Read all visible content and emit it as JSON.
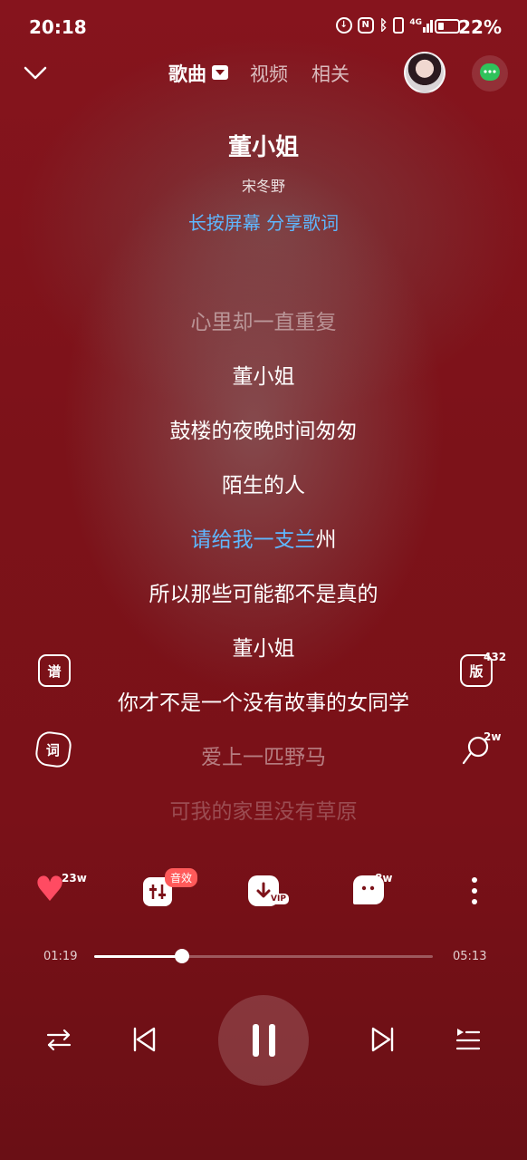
{
  "status_bar": {
    "time": "20:18",
    "battery_pct": "22%",
    "battery_level": 0.22,
    "icons": [
      "data-saver-icon",
      "nfc-icon",
      "bluetooth-icon",
      "vibrate-icon",
      "signal-4g-icon",
      "battery-icon"
    ],
    "signal_label": "4G"
  },
  "header": {
    "tabs": [
      {
        "label": "歌曲",
        "active": true
      },
      {
        "label": "视频",
        "active": false
      },
      {
        "label": "相关",
        "active": false
      }
    ]
  },
  "song": {
    "title": "董小姐",
    "artist": "宋冬野",
    "share_hint": "长按屏幕 分享歌词"
  },
  "lyrics": [
    {
      "text": "心里却一直重复",
      "state": "dim"
    },
    {
      "text": "董小姐",
      "state": "normal"
    },
    {
      "text": "鼓楼的夜晚时间匆匆",
      "state": "normal"
    },
    {
      "text": "陌生的人",
      "state": "normal"
    },
    {
      "text_sung": "请给我一支兰",
      "text_rest": "州",
      "state": "current"
    },
    {
      "text": "所以那些可能都不是真的",
      "state": "normal"
    },
    {
      "text": "董小姐",
      "state": "normal"
    },
    {
      "text": "你才不是一个没有故事的女同学",
      "state": "normal"
    },
    {
      "text": "爱上一匹野马",
      "state": "dim"
    },
    {
      "text": "可我的家里没有草原",
      "state": "faint"
    }
  ],
  "side_buttons": {
    "score": {
      "label": "谱"
    },
    "version": {
      "label": "版",
      "count": "432"
    },
    "lyric": {
      "label": "词"
    },
    "ringtone": {
      "count": "2w"
    }
  },
  "actions": {
    "like_count": "23w",
    "effects_tag": "音效",
    "vip_tag": "VIP",
    "comment_count": "8w"
  },
  "progress": {
    "current": "01:19",
    "total": "05:13",
    "fraction": 0.26
  },
  "colors": {
    "background": "#7a1118",
    "accent_blue": "#5fb7ff",
    "like_red": "#ff4b62",
    "chat_green": "#2fc25b"
  }
}
